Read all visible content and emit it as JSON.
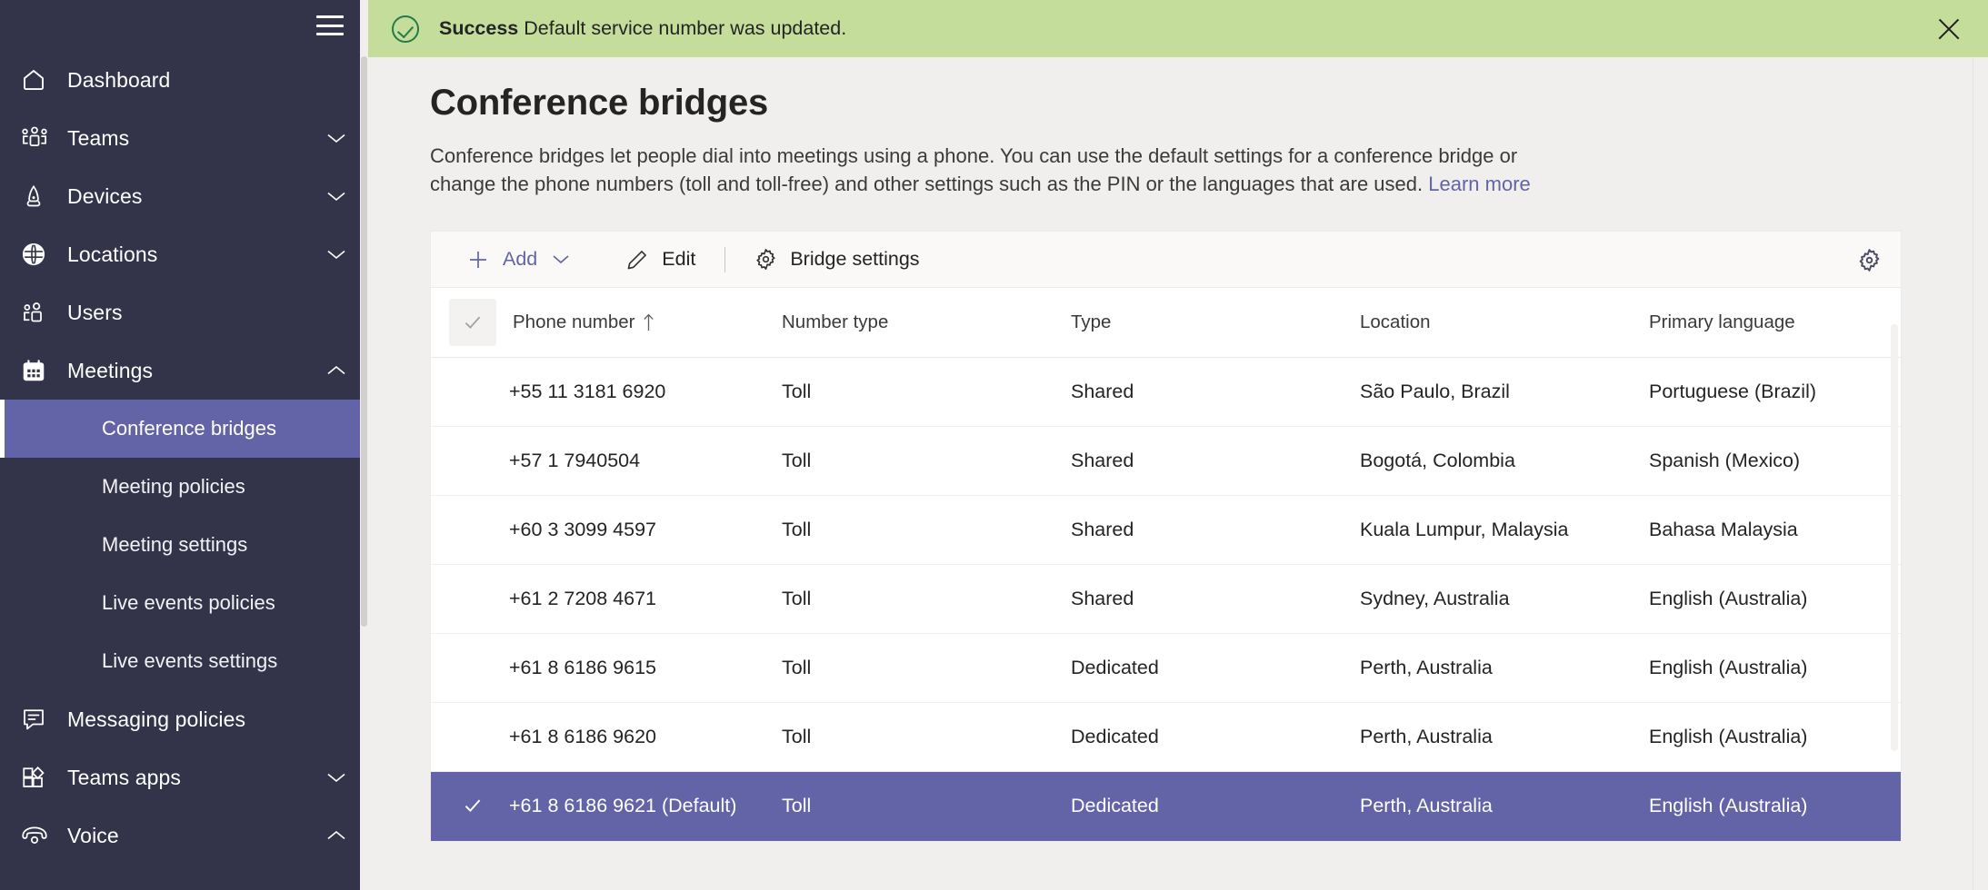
{
  "sidebar": {
    "menu_icon": "hamburger-icon",
    "items": [
      {
        "label": "Dashboard",
        "icon": "home-icon",
        "chevron": null
      },
      {
        "label": "Teams",
        "icon": "teams-icon",
        "chevron": "down"
      },
      {
        "label": "Devices",
        "icon": "devices-icon",
        "chevron": "down"
      },
      {
        "label": "Locations",
        "icon": "globe-icon",
        "chevron": "down"
      },
      {
        "label": "Users",
        "icon": "users-icon",
        "chevron": null
      },
      {
        "label": "Meetings",
        "icon": "calendar-icon",
        "chevron": "up"
      }
    ],
    "meetings_subitems": [
      {
        "label": "Conference bridges",
        "active": true
      },
      {
        "label": "Meeting policies",
        "active": false
      },
      {
        "label": "Meeting settings",
        "active": false
      },
      {
        "label": "Live events policies",
        "active": false
      },
      {
        "label": "Live events settings",
        "active": false
      }
    ],
    "items_after": [
      {
        "label": "Messaging policies",
        "icon": "message-icon",
        "chevron": null
      },
      {
        "label": "Teams apps",
        "icon": "apps-icon",
        "chevron": "down"
      },
      {
        "label": "Voice",
        "icon": "phone-icon",
        "chevron": "up"
      }
    ],
    "active_color": "#6264a7",
    "background_color": "#33344a"
  },
  "banner": {
    "icon": "success-check-circle-icon",
    "strong": "Success",
    "message": "Default service number was updated.",
    "close_icon": "close-icon",
    "background_color": "#c5dd9a"
  },
  "page": {
    "title": "Conference bridges",
    "description": "Conference bridges let people dial into meetings using a phone. You can use the default settings for a conference bridge or change the phone numbers (toll and toll-free) and other settings such as the PIN or the languages that are used.",
    "learn_more": "Learn more"
  },
  "toolbar": {
    "add_label": "Add",
    "add_icon": "plus-icon",
    "add_caret_icon": "chevron-down-icon",
    "edit_label": "Edit",
    "edit_icon": "pencil-icon",
    "bridge_settings_label": "Bridge settings",
    "bridge_settings_icon": "gear-icon",
    "settings_icon": "gear-icon"
  },
  "table": {
    "select_all_icon": "checkmark-icon",
    "columns": [
      {
        "key": "phone",
        "label": "Phone number",
        "sorted": "asc",
        "sort_icon": "arrow-up-icon"
      },
      {
        "key": "number_type",
        "label": "Number type"
      },
      {
        "key": "type",
        "label": "Type"
      },
      {
        "key": "location",
        "label": "Location"
      },
      {
        "key": "primary_language",
        "label": "Primary language"
      }
    ],
    "rows": [
      {
        "phone": "+55 11 3181 6920",
        "number_type": "Toll",
        "type": "Shared",
        "location": "São Paulo, Brazil",
        "primary_language": "Portuguese (Brazil)",
        "selected": false
      },
      {
        "phone": "+57 1 7940504",
        "number_type": "Toll",
        "type": "Shared",
        "location": "Bogotá, Colombia",
        "primary_language": "Spanish (Mexico)",
        "selected": false
      },
      {
        "phone": "+60 3 3099 4597",
        "number_type": "Toll",
        "type": "Shared",
        "location": "Kuala Lumpur, Malaysia",
        "primary_language": "Bahasa Malaysia",
        "selected": false
      },
      {
        "phone": "+61 2 7208 4671",
        "number_type": "Toll",
        "type": "Shared",
        "location": "Sydney, Australia",
        "primary_language": "English (Australia)",
        "selected": false
      },
      {
        "phone": "+61 8 6186 9615",
        "number_type": "Toll",
        "type": "Dedicated",
        "location": "Perth, Australia",
        "primary_language": "English (Australia)",
        "selected": false
      },
      {
        "phone": "+61 8 6186 9620",
        "number_type": "Toll",
        "type": "Dedicated",
        "location": "Perth, Australia",
        "primary_language": "English (Australia)",
        "selected": false
      },
      {
        "phone": "+61 8 6186 9621 (Default)",
        "number_type": "Toll",
        "type": "Dedicated",
        "location": "Perth, Australia",
        "primary_language": "English (Australia)",
        "selected": true
      }
    ],
    "selected_row_color": "#6264a7",
    "row_check_icon": "checkmark-icon"
  }
}
